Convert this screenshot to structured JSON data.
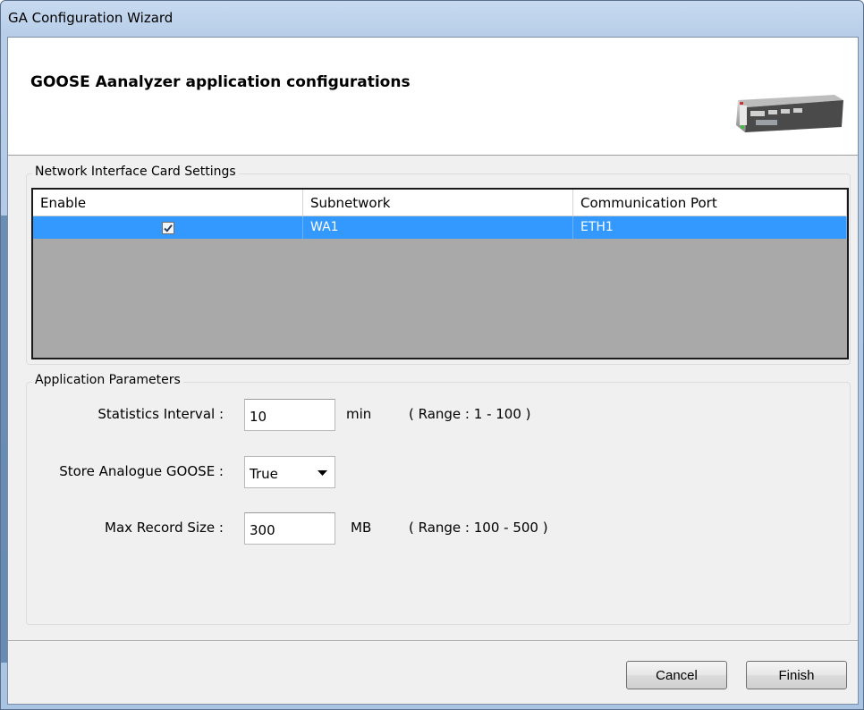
{
  "window": {
    "title": "GA Configuration Wizard"
  },
  "header": {
    "title": "GOOSE Aanalyzer application configurations",
    "image_icon": "network-appliance-image"
  },
  "nic_settings": {
    "legend": "Network Interface Card Settings",
    "columns": [
      "Enable",
      "Subnetwork",
      "Communication Port"
    ],
    "rows": [
      {
        "enable": true,
        "subnetwork": "WA1",
        "port": "ETH1",
        "selected": true
      }
    ],
    "selection_color": "#3399ff"
  },
  "app_params": {
    "legend": "Application Parameters",
    "statistics_interval": {
      "label": "Statistics Interval :",
      "value": "10",
      "unit": "min",
      "range": "( Range : 1 - 100 )"
    },
    "store_analogue": {
      "label": "Store Analogue GOOSE :",
      "value": "True"
    },
    "max_record_size": {
      "label": "Max Record Size :",
      "value": "300",
      "unit": "MB",
      "range": "( Range : 100 - 500 )"
    }
  },
  "buttons": {
    "cancel": "Cancel",
    "finish": "Finish"
  }
}
